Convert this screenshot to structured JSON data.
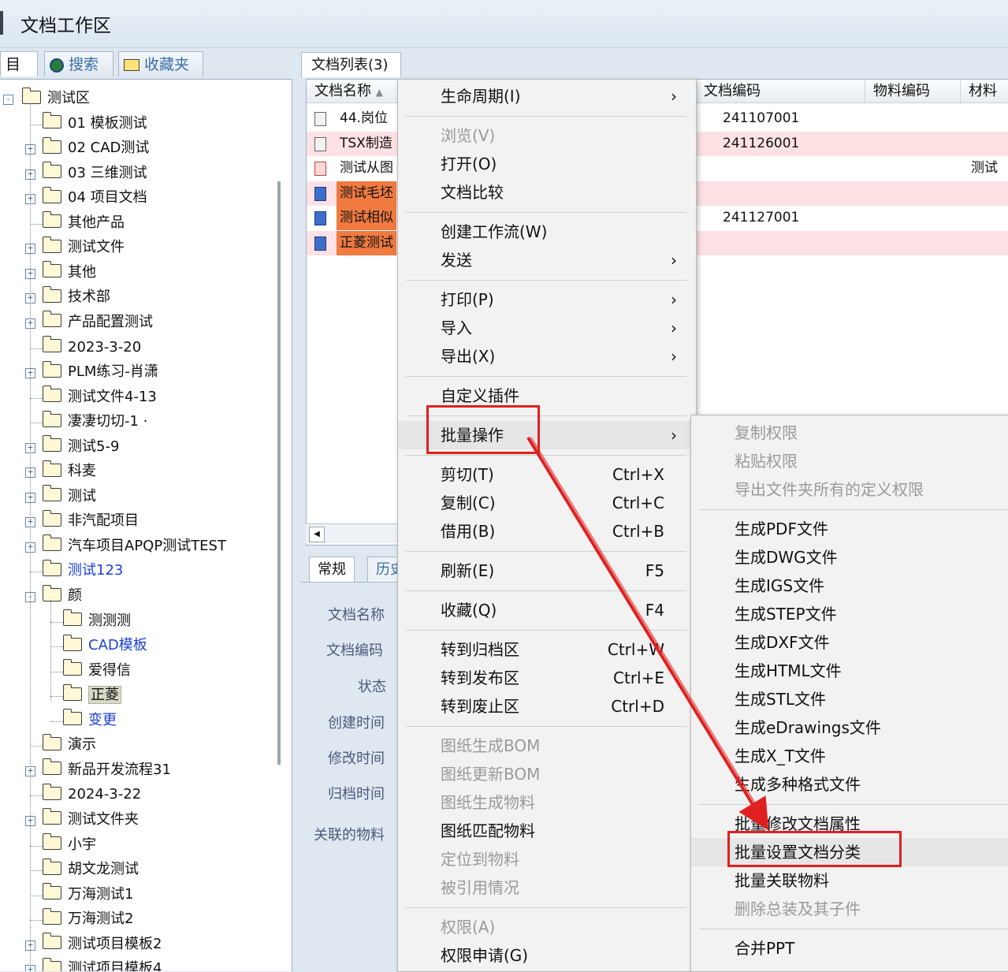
{
  "window": {
    "title": "文档工作区"
  },
  "left_tabs": [
    "目录",
    "搜索",
    "收藏夹"
  ],
  "tree": [
    {
      "label": "测试区",
      "depth": 0,
      "exp": "-"
    },
    {
      "label": "01 模板测试",
      "depth": 1,
      "exp": ""
    },
    {
      "label": "02 CAD测试",
      "depth": 1,
      "exp": "+"
    },
    {
      "label": "03 三维测试",
      "depth": 1,
      "exp": "+"
    },
    {
      "label": "04 项目文档",
      "depth": 1,
      "exp": "+"
    },
    {
      "label": "其他产品",
      "depth": 1,
      "exp": ""
    },
    {
      "label": "测试文件",
      "depth": 1,
      "exp": "+"
    },
    {
      "label": "其他",
      "depth": 1,
      "exp": "+"
    },
    {
      "label": "技术部",
      "depth": 1,
      "exp": "+"
    },
    {
      "label": "产品配置测试",
      "depth": 1,
      "exp": "+"
    },
    {
      "label": "2023-3-20",
      "depth": 1,
      "exp": ""
    },
    {
      "label": "PLM练习-肖潇",
      "depth": 1,
      "exp": "+"
    },
    {
      "label": "测试文件4-13",
      "depth": 1,
      "exp": ""
    },
    {
      "label": "凄凄切切-1 ·",
      "depth": 1,
      "exp": ""
    },
    {
      "label": "测试5-9",
      "depth": 1,
      "exp": "+"
    },
    {
      "label": "科麦",
      "depth": 1,
      "exp": "+"
    },
    {
      "label": "测试",
      "depth": 1,
      "exp": "+"
    },
    {
      "label": "非汽配项目",
      "depth": 1,
      "exp": "+"
    },
    {
      "label": "汽车项目APQP测试TEST",
      "depth": 1,
      "exp": "+"
    },
    {
      "label": "测试123",
      "depth": 1,
      "exp": "",
      "link": true
    },
    {
      "label": "颜",
      "depth": 1,
      "exp": "-"
    },
    {
      "label": "测测测",
      "depth": 2,
      "exp": ""
    },
    {
      "label": "CAD模板",
      "depth": 2,
      "exp": "",
      "link": true
    },
    {
      "label": "爱得信",
      "depth": 2,
      "exp": ""
    },
    {
      "label": "正菱",
      "depth": 2,
      "exp": "",
      "sel": true
    },
    {
      "label": "变更",
      "depth": 2,
      "exp": "",
      "link": true
    },
    {
      "label": "演示",
      "depth": 1,
      "exp": ""
    },
    {
      "label": "新品开发流程31",
      "depth": 1,
      "exp": "+"
    },
    {
      "label": "2024-3-22",
      "depth": 1,
      "exp": ""
    },
    {
      "label": "测试文件夹",
      "depth": 1,
      "exp": "+"
    },
    {
      "label": "小宇",
      "depth": 1,
      "exp": ""
    },
    {
      "label": "胡文龙测试",
      "depth": 1,
      "exp": ""
    },
    {
      "label": "万海测试1",
      "depth": 1,
      "exp": ""
    },
    {
      "label": "万海测试2",
      "depth": 1,
      "exp": ""
    },
    {
      "label": "测试项目模板2",
      "depth": 1,
      "exp": "+"
    },
    {
      "label": "测试项目模板4",
      "depth": 1,
      "exp": "+"
    }
  ],
  "doc_list": {
    "tab_label": "文档列表(3)",
    "columns": [
      "文档名称",
      "文档编码",
      "物料编码",
      "材料"
    ],
    "rows": [
      {
        "name": "44.岗位",
        "code": "241107001",
        "mat": "",
        "icon": "plain",
        "pink": false,
        "orange": false
      },
      {
        "name": "TSX制造",
        "code": "241126001",
        "mat": "",
        "icon": "plain",
        "pink": true,
        "orange": false
      },
      {
        "name": "测试从图",
        "code": "",
        "mat": "测试",
        "icon": "red",
        "pink": false,
        "orange": false
      },
      {
        "name": "测试毛坯",
        "code": "",
        "mat": "",
        "icon": "blue",
        "pink": true,
        "orange": true
      },
      {
        "name": "测试相似",
        "code": "241127001",
        "mat": "",
        "icon": "blue",
        "pink": false,
        "orange": true
      },
      {
        "name": "正菱测试",
        "code": "",
        "mat": "",
        "icon": "blue",
        "pink": true,
        "orange": true
      }
    ]
  },
  "props": {
    "tabs": [
      "常规",
      "历史"
    ],
    "labels": [
      "文档名称",
      "文档编码",
      "状态",
      "创建时间",
      "修改时间",
      "归档时间",
      "关联的物料"
    ]
  },
  "context_menu": [
    {
      "label": "生命周期(I)",
      "arrow": true
    },
    {
      "sep": true
    },
    {
      "label": "浏览(V)",
      "disabled": true
    },
    {
      "label": "打开(O)"
    },
    {
      "label": "文档比较"
    },
    {
      "sep": true
    },
    {
      "label": "创建工作流(W)"
    },
    {
      "label": "发送",
      "arrow": true
    },
    {
      "sep": true
    },
    {
      "label": "打印(P)",
      "arrow": true
    },
    {
      "label": "导入",
      "arrow": true
    },
    {
      "label": "导出(X)",
      "arrow": true
    },
    {
      "sep": true
    },
    {
      "label": "自定义插件"
    },
    {
      "sep": true
    },
    {
      "label": "批量操作",
      "arrow": true,
      "highlight": true
    },
    {
      "sep": true
    },
    {
      "label": "剪切(T)",
      "shortcut": "Ctrl+X"
    },
    {
      "label": "复制(C)",
      "shortcut": "Ctrl+C"
    },
    {
      "label": "借用(B)",
      "shortcut": "Ctrl+B"
    },
    {
      "sep": true
    },
    {
      "label": "刷新(E)",
      "shortcut": "F5"
    },
    {
      "sep": true
    },
    {
      "label": "收藏(Q)",
      "shortcut": "F4"
    },
    {
      "sep": true
    },
    {
      "label": "转到归档区",
      "shortcut": "Ctrl+W"
    },
    {
      "label": "转到发布区",
      "shortcut": "Ctrl+E"
    },
    {
      "label": "转到废止区",
      "shortcut": "Ctrl+D"
    },
    {
      "sep": true
    },
    {
      "label": "图纸生成BOM",
      "disabled": true
    },
    {
      "label": "图纸更新BOM",
      "disabled": true
    },
    {
      "label": "图纸生成物料",
      "disabled": true
    },
    {
      "label": "图纸匹配物料"
    },
    {
      "label": "定位到物料",
      "disabled": true
    },
    {
      "label": "被引用情况",
      "disabled": true
    },
    {
      "sep": true
    },
    {
      "label": "权限(A)",
      "disabled": true
    },
    {
      "label": "权限申请(G)"
    }
  ],
  "submenu": [
    {
      "label": "复制权限",
      "disabled": true
    },
    {
      "label": "粘贴权限",
      "disabled": true
    },
    {
      "label": "导出文件夹所有的定义权限",
      "disabled": true
    },
    {
      "sep": true
    },
    {
      "label": "生成PDF文件"
    },
    {
      "label": "生成DWG文件"
    },
    {
      "label": "生成IGS文件"
    },
    {
      "label": "生成STEP文件"
    },
    {
      "label": "生成DXF文件"
    },
    {
      "label": "生成HTML文件"
    },
    {
      "label": "生成STL文件"
    },
    {
      "label": "生成eDrawings文件"
    },
    {
      "label": "生成X_T文件"
    },
    {
      "label": "生成多种格式文件"
    },
    {
      "sep": true
    },
    {
      "label": "批量修改文档属性"
    },
    {
      "label": "批量设置文档分类",
      "highlight": true
    },
    {
      "label": "批量关联物料"
    },
    {
      "label": "删除总装及其子件",
      "disabled": true
    },
    {
      "sep": true
    },
    {
      "label": "合并PPT"
    }
  ],
  "colors": {
    "annotation": "#e02020",
    "link": "#1a3fd8",
    "pink_row": "#fde1e4",
    "orange_cell": "#f07a40"
  }
}
